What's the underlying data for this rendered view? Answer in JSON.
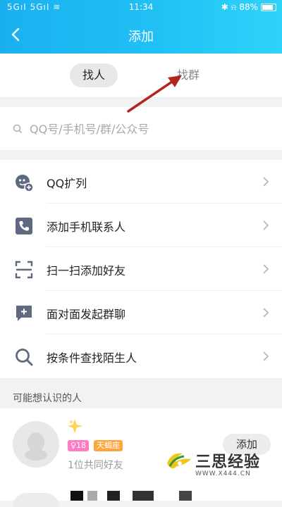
{
  "status_bar": {
    "left": "5GıI 5GıI ≋",
    "time": "11:34",
    "right": "✱ ⍾ 88%"
  },
  "header": {
    "title": "添加"
  },
  "tabs": [
    {
      "label": "找人",
      "active": true
    },
    {
      "label": "找群",
      "active": false
    }
  ],
  "search": {
    "placeholder": "QQ号/手机号/群/公众号"
  },
  "menu": [
    {
      "label": "QQ扩列",
      "icon": "qq-expand-icon"
    },
    {
      "label": "添加手机联系人",
      "icon": "phone-icon"
    },
    {
      "label": "扫一扫添加好友",
      "icon": "scan-icon"
    },
    {
      "label": "面对面发起群聊",
      "icon": "chat-plus-icon"
    },
    {
      "label": "按条件查找陌生人",
      "icon": "search-icon"
    }
  ],
  "section_title": "可能想认识的人",
  "suggestion": {
    "age_badge": "♀18",
    "zodiac_badge": "天蝎座",
    "mutual": "1位共同好友",
    "add_label": "添加"
  },
  "watermark": {
    "text": "三思经验",
    "url": "WWW.X444.CN"
  },
  "colors": {
    "header_start": "#1ab0f0",
    "header_end": "#2fd3f8",
    "icon": "#5f6a80",
    "arrow": "#b3251f"
  }
}
